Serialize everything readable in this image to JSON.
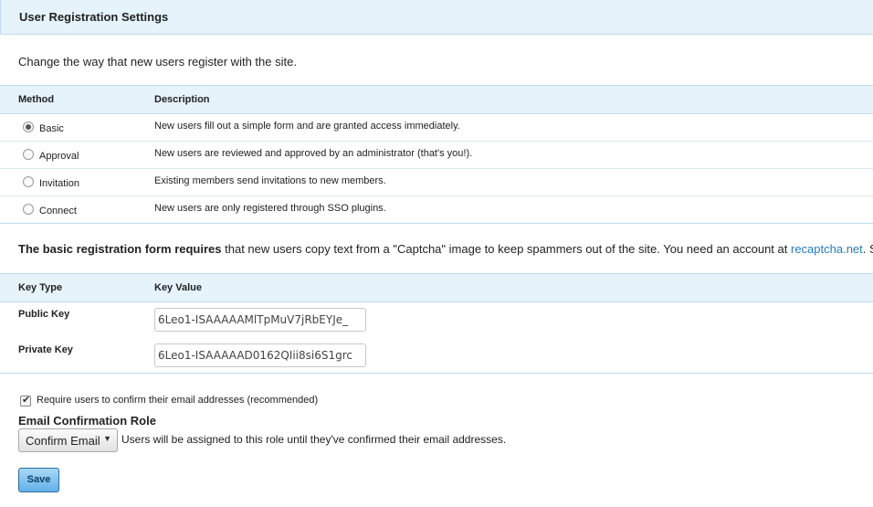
{
  "header": {
    "title": "User Registration Settings"
  },
  "intro": "Change the way that new users register with the site.",
  "methods_table": {
    "col_method": "Method",
    "col_description": "Description",
    "rows": [
      {
        "label": "Basic",
        "description": "New users fill out a simple form and are granted access immediately.",
        "selected": true
      },
      {
        "label": "Approval",
        "description": "New users are reviewed and approved by an administrator (that's you!).",
        "selected": false
      },
      {
        "label": "Invitation",
        "description": "Existing members send invitations to new members.",
        "selected": false
      },
      {
        "label": "Connect",
        "description": "New users are only registered through SSO plugins.",
        "selected": false
      }
    ]
  },
  "captcha": {
    "bold": "The basic registration form requires",
    "text": " that new users copy text from a \"Captcha\" image to keep spammers out of the site. You need an account at ",
    "link": "recaptcha.net",
    "after": ". Si"
  },
  "keys_table": {
    "col_type": "Key Type",
    "col_value": "Key Value",
    "public_label": "Public Key",
    "public_value": "6Leo1-ISAAAAAMlTpMuV7jRbEYJe_",
    "private_label": "Private Key",
    "private_value": "6Leo1-ISAAAAAD0162QIii8si6S1grc"
  },
  "confirm_email": {
    "label": "Require users to confirm their email addresses (recommended)",
    "checked": true
  },
  "role": {
    "title": "Email Confirmation Role",
    "selected": "Confirm Email",
    "description": "Users will be assigned to this role until they've confirmed their email addresses."
  },
  "save_label": "Save",
  "colors": {
    "header_bg": "#e6f3fb",
    "link": "#2b7bb9",
    "save_button": "#62b1e8"
  }
}
